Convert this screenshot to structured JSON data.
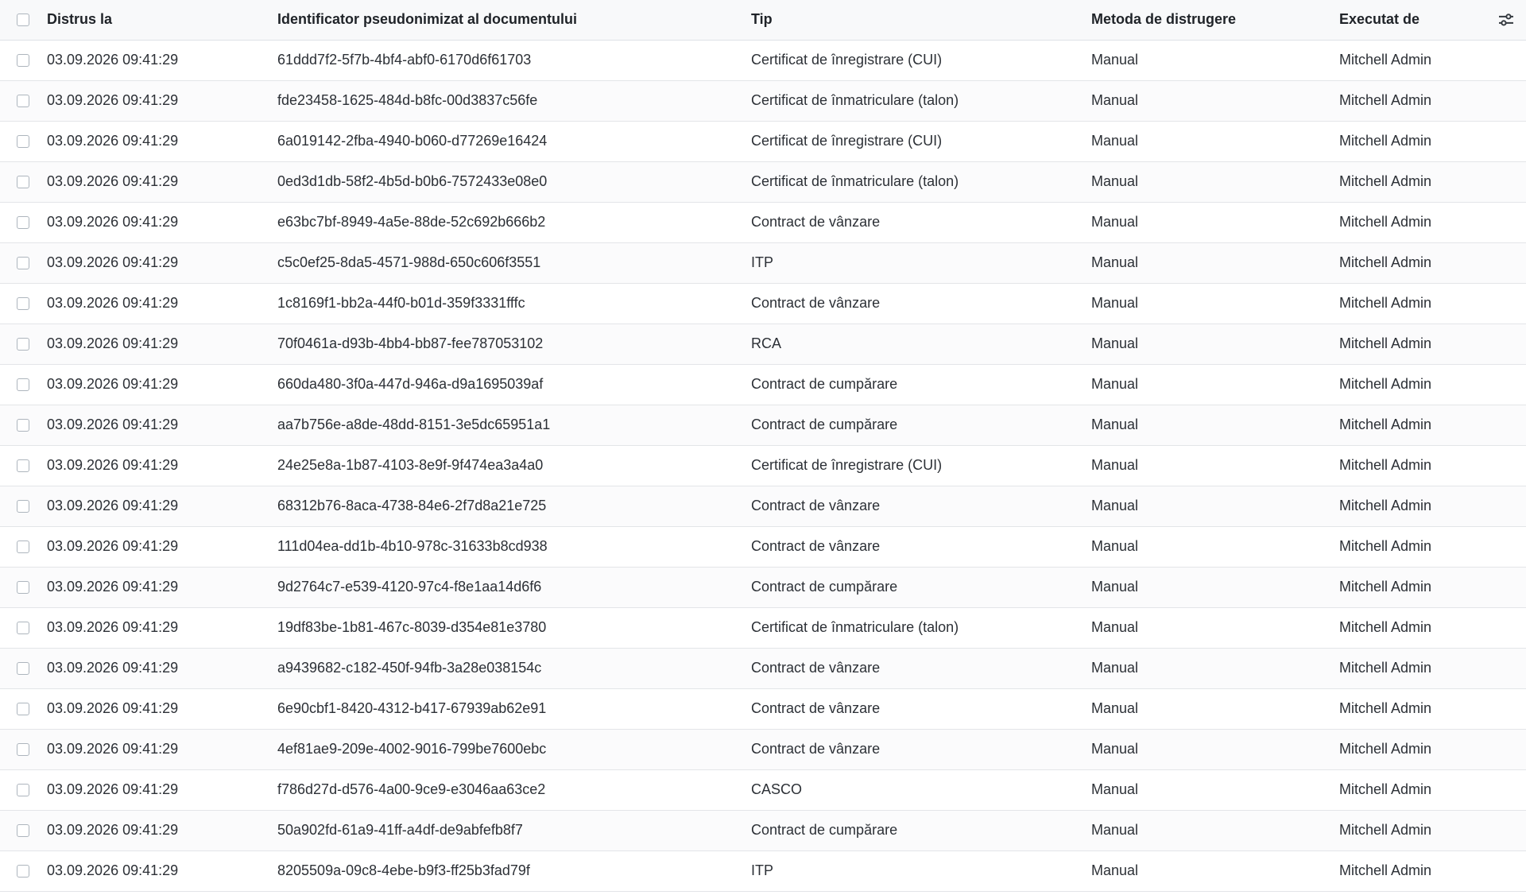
{
  "columns": {
    "destroyed_at": "Distrus la",
    "document_id": "Identificator pseudonimizat al documentului",
    "type": "Tip",
    "method": "Metoda de distrugere",
    "executed_by": "Executat de"
  },
  "rows": [
    {
      "destroyed_at": "03.09.2026 09:41:29",
      "document_id": "61ddd7f2-5f7b-4bf4-abf0-6170d6f61703",
      "type": "Certificat de înregistrare (CUI)",
      "method": "Manual",
      "executed_by": "Mitchell Admin"
    },
    {
      "destroyed_at": "03.09.2026 09:41:29",
      "document_id": "fde23458-1625-484d-b8fc-00d3837c56fe",
      "type": "Certificat de înmatriculare (talon)",
      "method": "Manual",
      "executed_by": "Mitchell Admin"
    },
    {
      "destroyed_at": "03.09.2026 09:41:29",
      "document_id": "6a019142-2fba-4940-b060-d77269e16424",
      "type": "Certificat de înregistrare (CUI)",
      "method": "Manual",
      "executed_by": "Mitchell Admin"
    },
    {
      "destroyed_at": "03.09.2026 09:41:29",
      "document_id": "0ed3d1db-58f2-4b5d-b0b6-7572433e08e0",
      "type": "Certificat de înmatriculare (talon)",
      "method": "Manual",
      "executed_by": "Mitchell Admin"
    },
    {
      "destroyed_at": "03.09.2026 09:41:29",
      "document_id": "e63bc7bf-8949-4a5e-88de-52c692b666b2",
      "type": "Contract de vânzare",
      "method": "Manual",
      "executed_by": "Mitchell Admin"
    },
    {
      "destroyed_at": "03.09.2026 09:41:29",
      "document_id": "c5c0ef25-8da5-4571-988d-650c606f3551",
      "type": "ITP",
      "method": "Manual",
      "executed_by": "Mitchell Admin"
    },
    {
      "destroyed_at": "03.09.2026 09:41:29",
      "document_id": "1c8169f1-bb2a-44f0-b01d-359f3331fffc",
      "type": "Contract de vânzare",
      "method": "Manual",
      "executed_by": "Mitchell Admin"
    },
    {
      "destroyed_at": "03.09.2026 09:41:29",
      "document_id": "70f0461a-d93b-4bb4-bb87-fee787053102",
      "type": "RCA",
      "method": "Manual",
      "executed_by": "Mitchell Admin"
    },
    {
      "destroyed_at": "03.09.2026 09:41:29",
      "document_id": "660da480-3f0a-447d-946a-d9a1695039af",
      "type": "Contract de cumpărare",
      "method": "Manual",
      "executed_by": "Mitchell Admin"
    },
    {
      "destroyed_at": "03.09.2026 09:41:29",
      "document_id": "aa7b756e-a8de-48dd-8151-3e5dc65951a1",
      "type": "Contract de cumpărare",
      "method": "Manual",
      "executed_by": "Mitchell Admin"
    },
    {
      "destroyed_at": "03.09.2026 09:41:29",
      "document_id": "24e25e8a-1b87-4103-8e9f-9f474ea3a4a0",
      "type": "Certificat de înregistrare (CUI)",
      "method": "Manual",
      "executed_by": "Mitchell Admin"
    },
    {
      "destroyed_at": "03.09.2026 09:41:29",
      "document_id": "68312b76-8aca-4738-84e6-2f7d8a21e725",
      "type": "Contract de vânzare",
      "method": "Manual",
      "executed_by": "Mitchell Admin"
    },
    {
      "destroyed_at": "03.09.2026 09:41:29",
      "document_id": "111d04ea-dd1b-4b10-978c-31633b8cd938",
      "type": "Contract de vânzare",
      "method": "Manual",
      "executed_by": "Mitchell Admin"
    },
    {
      "destroyed_at": "03.09.2026 09:41:29",
      "document_id": "9d2764c7-e539-4120-97c4-f8e1aa14d6f6",
      "type": "Contract de cumpărare",
      "method": "Manual",
      "executed_by": "Mitchell Admin"
    },
    {
      "destroyed_at": "03.09.2026 09:41:29",
      "document_id": "19df83be-1b81-467c-8039-d354e81e3780",
      "type": "Certificat de înmatriculare (talon)",
      "method": "Manual",
      "executed_by": "Mitchell Admin"
    },
    {
      "destroyed_at": "03.09.2026 09:41:29",
      "document_id": "a9439682-c182-450f-94fb-3a28e038154c",
      "type": "Contract de vânzare",
      "method": "Manual",
      "executed_by": "Mitchell Admin"
    },
    {
      "destroyed_at": "03.09.2026 09:41:29",
      "document_id": "6e90cbf1-8420-4312-b417-67939ab62e91",
      "type": "Contract de vânzare",
      "method": "Manual",
      "executed_by": "Mitchell Admin"
    },
    {
      "destroyed_at": "03.09.2026 09:41:29",
      "document_id": "4ef81ae9-209e-4002-9016-799be7600ebc",
      "type": "Contract de vânzare",
      "method": "Manual",
      "executed_by": "Mitchell Admin"
    },
    {
      "destroyed_at": "03.09.2026 09:41:29",
      "document_id": "f786d27d-d576-4a00-9ce9-e3046aa63ce2",
      "type": "CASCO",
      "method": "Manual",
      "executed_by": "Mitchell Admin"
    },
    {
      "destroyed_at": "03.09.2026 09:41:29",
      "document_id": "50a902fd-61a9-41ff-a4df-de9abfefb8f7",
      "type": "Contract de cumpărare",
      "method": "Manual",
      "executed_by": "Mitchell Admin"
    },
    {
      "destroyed_at": "03.09.2026 09:41:29",
      "document_id": "8205509a-09c8-4ebe-b9f3-ff25b3fad79f",
      "type": "ITP",
      "method": "Manual",
      "executed_by": "Mitchell Admin"
    }
  ],
  "icons": {
    "header_checkbox": "checkbox-icon",
    "column_options": "sliders-icon"
  },
  "colors": {
    "header_background": "#f8f9fa",
    "border": "#dee2e6",
    "text": "#212529"
  }
}
